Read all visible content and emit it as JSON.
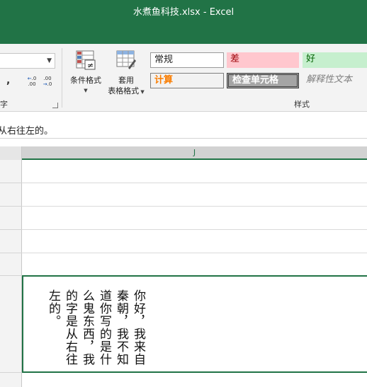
{
  "window": {
    "title": "水煮鱼科技.xlsx  -  Excel"
  },
  "ribbon": {
    "number": {
      "format_value": "",
      "comma_label": ",",
      "increase_decimal": {
        "top": ".0",
        "bottom": ".00",
        "arrow": "←"
      },
      "decrease_decimal": {
        "top": ".00",
        "bottom": ".0",
        "arrow": "→"
      },
      "group_label": "数字"
    },
    "styles": {
      "conditional_format_label": "条件格式",
      "table_format_line1": "套用",
      "table_format_line2": "表格格式",
      "cells": {
        "normal": "常规",
        "bad": "差",
        "good": "好",
        "calc": "计算",
        "check": "检查单元格",
        "explain": "解释性文本"
      },
      "group_label": "样式"
    }
  },
  "formula_bar": {
    "text": "从右往左的。"
  },
  "sheet": {
    "column_header": "J",
    "cell_text": "你好，我来自秦朝，我不知道你写的是什么鬼东西，我的字是从右往左的。"
  }
}
